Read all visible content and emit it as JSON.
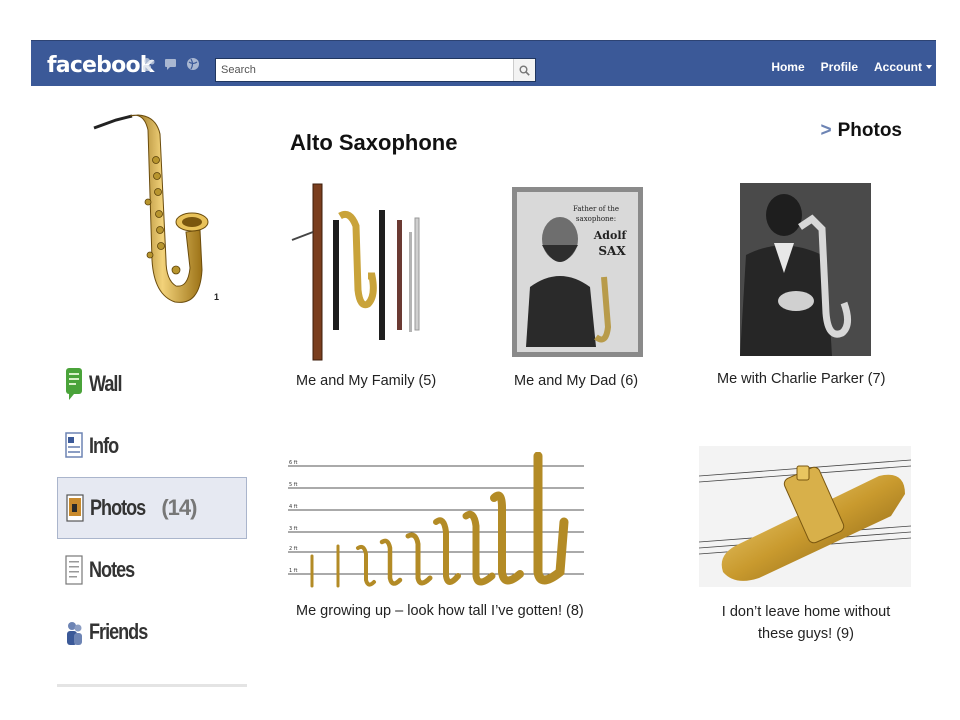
{
  "header": {
    "logo": "facebook",
    "search_placeholder": "Search",
    "nav": [
      {
        "label": "Home"
      },
      {
        "label": "Profile"
      },
      {
        "label": "Account"
      }
    ]
  },
  "profile": {
    "picture_caption": "1"
  },
  "sidebar": {
    "items": [
      {
        "label": "Wall",
        "icon": "wall-icon"
      },
      {
        "label": "Info",
        "icon": "info-icon"
      },
      {
        "label": "Photos",
        "count": "(14)",
        "icon": "photos-icon",
        "active": true
      },
      {
        "label": "Notes",
        "icon": "notes-icon"
      },
      {
        "label": "Friends",
        "icon": "friends-icon"
      }
    ]
  },
  "main": {
    "title": "Alto Saxophone",
    "breadcrumb_sep": ">",
    "breadcrumb": "Photos",
    "photos": [
      {
        "caption": "Me and My Family (5)"
      },
      {
        "caption": "Me and My Dad (6)"
      },
      {
        "caption": "Me with Charlie Parker (7)"
      },
      {
        "caption": "Me growing up – look how tall I’ve gotten! (8)"
      },
      {
        "caption": "I don’t leave home without these guys! (9)"
      }
    ],
    "dad_photo_text": [
      "Father of the",
      "saxophone:",
      "Adolf",
      "SAX"
    ]
  },
  "colors": {
    "brand": "#3b5998",
    "active_bg": "#e6e9f2",
    "brass": "#c9a33a"
  }
}
